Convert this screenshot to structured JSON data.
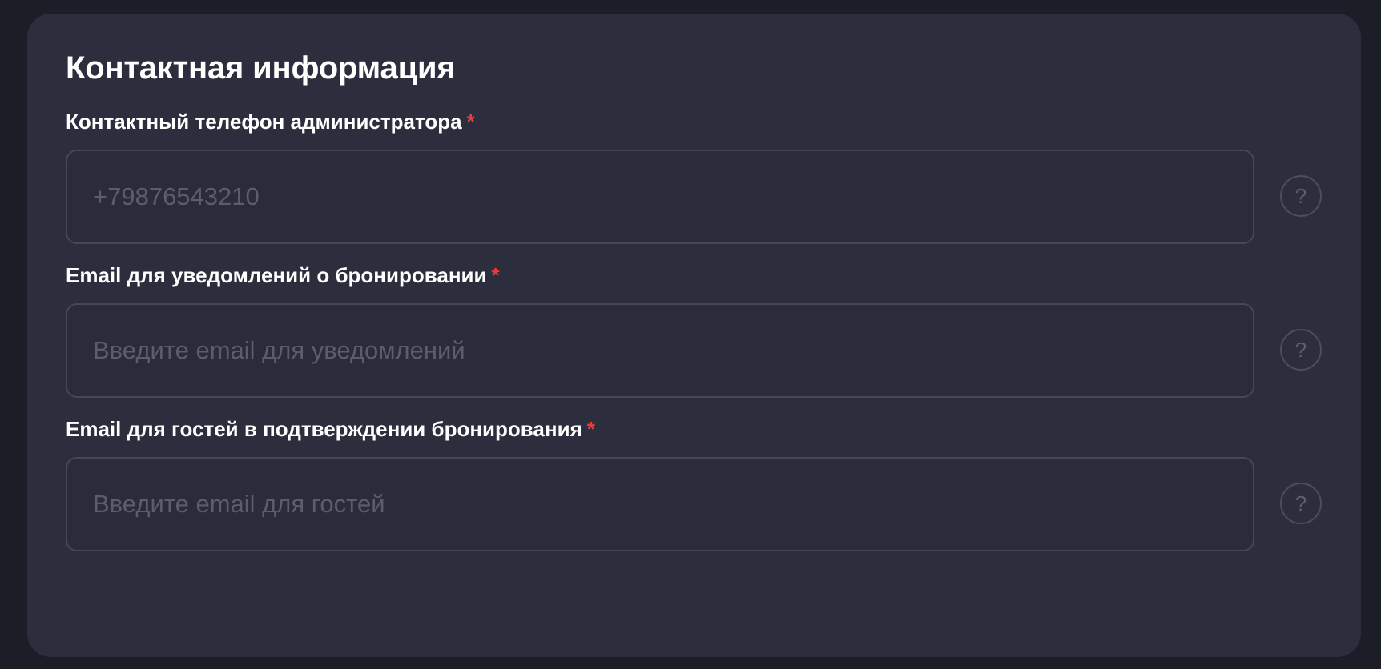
{
  "section": {
    "title": "Контактная информация"
  },
  "fields": [
    {
      "label": "Контактный телефон администратора",
      "required_mark": "*",
      "value": "",
      "placeholder": "+79876543210",
      "help_icon": "question-mark-icon",
      "help_glyph": "?"
    },
    {
      "label": "Email для уведомлений о бронировании",
      "required_mark": "*",
      "value": "",
      "placeholder": "Введите email для уведомлений",
      "help_icon": "question-mark-icon",
      "help_glyph": "?"
    },
    {
      "label": "Email для гостей в подтверждении бронирования",
      "required_mark": "*",
      "value": "",
      "placeholder": "Введите email для гостей",
      "help_icon": "question-mark-icon",
      "help_glyph": "?"
    }
  ],
  "colors": {
    "page_background": "#1c1e27",
    "card_background": "#2d2e3d",
    "input_border": "#454757",
    "placeholder_text": "#5b5d6d",
    "required_mark": "#ef3b3b",
    "text_primary": "#ffffff"
  }
}
